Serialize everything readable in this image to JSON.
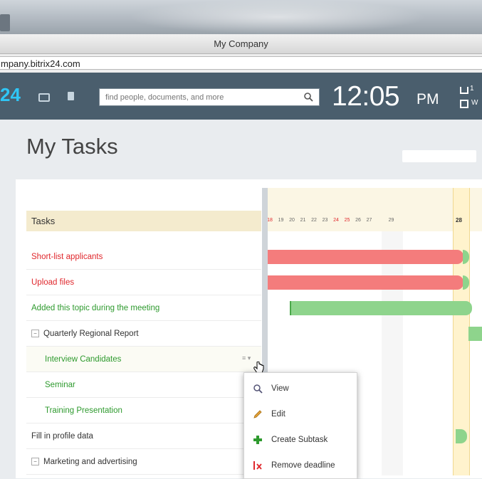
{
  "window": {
    "title": "My Company"
  },
  "browser": {
    "url": "mpany.bitrix24.com"
  },
  "header": {
    "logo_text": "24",
    "search_placeholder": "find people, documents, and more",
    "clock": "12:05",
    "clock_ampm": "PM",
    "status_a": "1",
    "status_b": "W"
  },
  "page": {
    "title": "My Tasks"
  },
  "tasks": {
    "header": "Tasks",
    "rows": [
      {
        "label": "Short-list applicants",
        "color": "#e0282d"
      },
      {
        "label": "Upload files",
        "color": "#e0282d"
      },
      {
        "label": "Added this topic during the meeting",
        "color": "#2e9a2e"
      },
      {
        "label": "Quarterly Regional Report",
        "color": "#333333",
        "group": true
      },
      {
        "label": "Interview Candidates",
        "color": "#2e9a2e",
        "indent": true
      },
      {
        "label": "Seminar",
        "color": "#2e9a2e",
        "indent": true
      },
      {
        "label": "Training Presentation",
        "color": "#2e9a2e",
        "indent": true
      },
      {
        "label": "Fill in profile data",
        "color": "#333333"
      },
      {
        "label": "Marketing and advertising",
        "color": "#333333",
        "group": true
      }
    ]
  },
  "gantt": {
    "days": [
      "18",
      "19",
      "20",
      "21",
      "22",
      "23",
      "24",
      "25",
      "26",
      "27",
      "28",
      "29"
    ],
    "weekend_days": [
      "18",
      "24",
      "25"
    ],
    "today": "28"
  },
  "context_menu": {
    "items": [
      {
        "label": "View",
        "icon": "magnifier-icon"
      },
      {
        "label": "Edit",
        "icon": "pencil-icon"
      },
      {
        "label": "Create Subtask",
        "icon": "plus-icon"
      },
      {
        "label": "Remove deadline",
        "icon": "remove-deadline-icon"
      }
    ]
  },
  "colors": {
    "accent": "#2fc6f6",
    "header_bg": "#4a5e6d",
    "overdue": "#e0282d",
    "in_progress": "#2e9a2e"
  }
}
